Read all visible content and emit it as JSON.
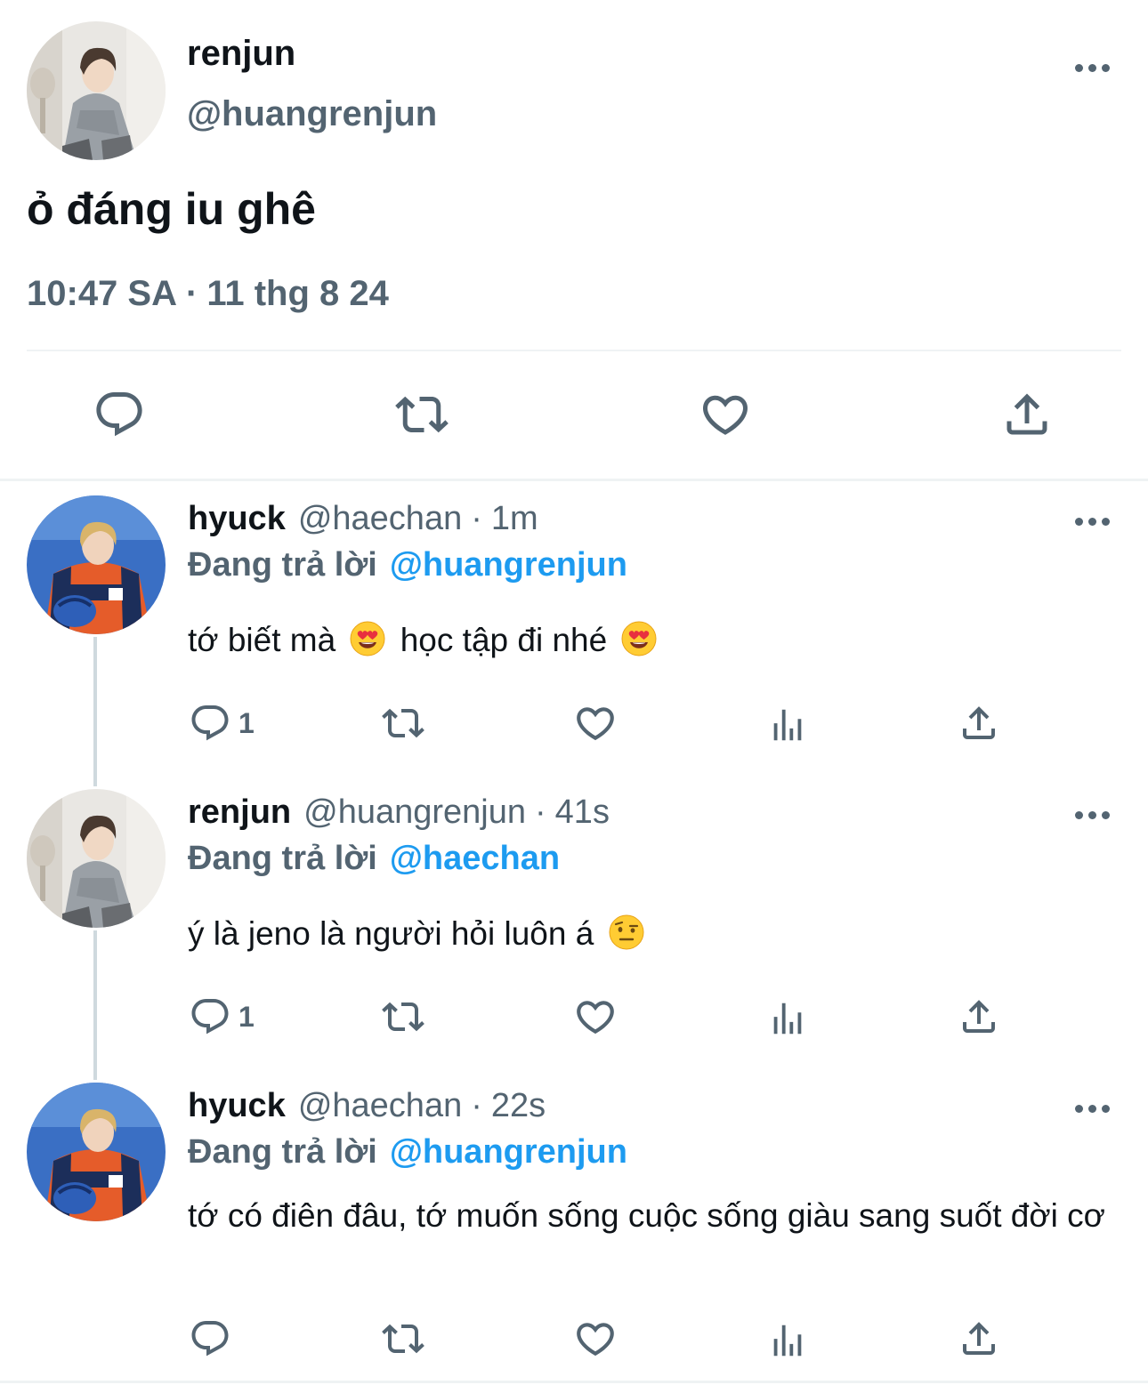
{
  "main_tweet": {
    "display_name": "renjun",
    "handle": "@huangrenjun",
    "text": "ỏ đáng iu ghê",
    "time": "10:47 SA",
    "separator": "·",
    "date": "11 thg 8 24",
    "actions": [
      "reply-icon",
      "retweet-icon",
      "like-icon",
      "share-icon"
    ]
  },
  "replies": [
    {
      "display_name": "hyuck",
      "handle": "@haechan",
      "separator": "·",
      "time": "1m",
      "replying_prefix": "Đang trả lời",
      "replying_to": "@huangrenjun",
      "text_a": "tớ biết mà",
      "emoji_a": "smiling-face-with-heart-eyes",
      "text_b": "học tập đi nhé",
      "emoji_b": "smiling-face-with-heart-eyes",
      "reply_count": "1"
    },
    {
      "display_name": "renjun",
      "handle": "@huangrenjun",
      "separator": "·",
      "time": "41s",
      "replying_prefix": "Đang trả lời",
      "replying_to": "@haechan",
      "text_a": "ý là jeno là người hỏi luôn á",
      "emoji_a": "face-with-raised-eyebrow",
      "reply_count": "1"
    },
    {
      "display_name": "hyuck",
      "handle": "@haechan",
      "separator": "·",
      "time": "22s",
      "replying_prefix": "Đang trả lời",
      "replying_to": "@huangrenjun",
      "text_a": "tớ có điên đâu, tớ muốn sống cuộc sống giàu sang suốt đời cơ",
      "reply_count": ""
    }
  ],
  "colors": {
    "text_primary": "#0f1419",
    "text_secondary": "#536471",
    "accent": "#1d9bf0",
    "divider": "#eff3f4",
    "thread_line": "#cfd9de"
  }
}
